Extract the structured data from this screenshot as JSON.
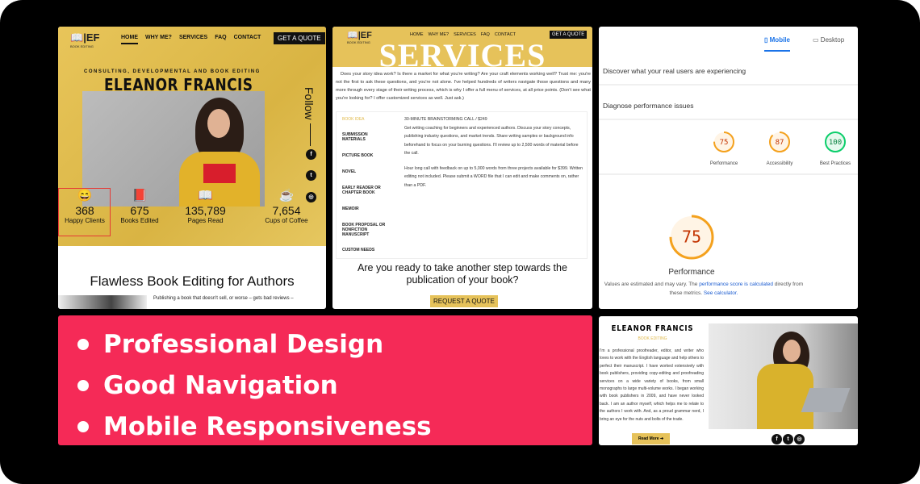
{
  "home": {
    "logo": "EF",
    "logo_sub": "BOOK EDITING",
    "nav": [
      "HOME",
      "WHY ME?",
      "SERVICES",
      "FAQ",
      "CONTACT"
    ],
    "cta": "GET A QUOTE",
    "tagline": "CONSULTING, DEVELOPMENTAL AND BOOK EDITING",
    "name": "ELEANOR FRANCIS",
    "follow": "Follow",
    "social": [
      "facebook-icon",
      "twitter-icon",
      "instagram-icon"
    ],
    "stats": [
      {
        "icon": "smile-icon",
        "value": "368",
        "label": "Happy Clients"
      },
      {
        "icon": "book-icon",
        "value": "675",
        "label": "Books Edited"
      },
      {
        "icon": "reader-icon",
        "value": "135,789",
        "label": "Pages Read"
      },
      {
        "icon": "coffee-icon",
        "value": "7,654",
        "label": "Cups of Coffee"
      }
    ],
    "heading": "Flawless Book Editing for Authors",
    "snippet": "Publishing a book that doesn't sell, or worse – gets bad reviews –"
  },
  "services": {
    "logo": "EF",
    "logo_sub": "BOOK EDITING",
    "nav": [
      "HOME",
      "WHY ME?",
      "SERVICES",
      "FAQ",
      "CONTACT"
    ],
    "cta": "GET A QUOTE",
    "title": "SERVICES",
    "intro": "Does your story idea work? Is there a market for what you're writing? Are your craft elements working well? Trust me: you're not the first to ask these questions, and you're not alone. I've helped hundreds of writers navigate those questions and many more through every stage of their writing process, which is why I offer a full menu of services, at all price points. (Don't see what you're looking for? I offer customized services as well. Just ask.)",
    "tabs": [
      "BOOK IDEA",
      "SUBMISSION MATERIALS",
      "PICTURE BOOK",
      "NOVEL",
      "EARLY READER OR CHAPTER BOOK",
      "MEMOIR",
      "BOOK PROPOSAL OR NONFICTION MANUSCRIPT",
      "CUSTOM NEEDS"
    ],
    "content_title": "30-MINUTE BRAINSTORMING CALL / $249",
    "content_p1": "Get writing coaching for beginners and experienced authors. Discuss your story concepts, publishing industry questions, and market trends. Share writing samples or background info beforehand to focus on your burning questions. I'll review up to 2,500 words of material before the call.",
    "content_p2": "Hour long call with feedback on up to 5,000 words from three projects available for $399. Written editing not included. Please submit a WORD file that I can edit and make comments on, rather than a PDF.",
    "ready": "Are you ready to take another step towards the publication of your book?",
    "request": "REQUEST A QUOTE"
  },
  "pagespeed": {
    "tabs": [
      "Mobile",
      "Desktop"
    ],
    "discover": "Discover what your real users are experiencing",
    "diagnose": "Diagnose performance issues",
    "scores": [
      {
        "value": 75,
        "label": "Performance",
        "color": "#f4a11d"
      },
      {
        "value": 87,
        "label": "Accessibility",
        "color": "#f4a11d"
      },
      {
        "value": 100,
        "label": "Best Practices",
        "color": "#0cce6b"
      }
    ],
    "main_score": 75,
    "main_label": "Performance",
    "note_a": "Values are estimated and may vary. The ",
    "note_link": "performance score is calculated",
    "note_b": " directly from these metrics. ",
    "note_link2": "See calculator."
  },
  "banner": {
    "items": [
      "Professional Design",
      "Good Navigation",
      "Mobile Responsiveness"
    ],
    "color": "#f52a57"
  },
  "about": {
    "name": "ELEANOR FRANCIS",
    "sub": "BOOK EDITING",
    "text": "I'm a professional proofreader, editor, and writer who loves to work with the English language and help others to perfect their manuscript. I have worked extensively with book publishers, providing copy-editing and proofreading services on a wide variety of books, from small monographs to large multi-volume works. I began working with book publishers in 2009, and have never looked back. I am an author myself, which helps me to relate to the authors I work with. And, as a proud grammar nerd, I bring an eye for the nuts and bolts of the trade.",
    "read_more": "Read More ➔"
  }
}
